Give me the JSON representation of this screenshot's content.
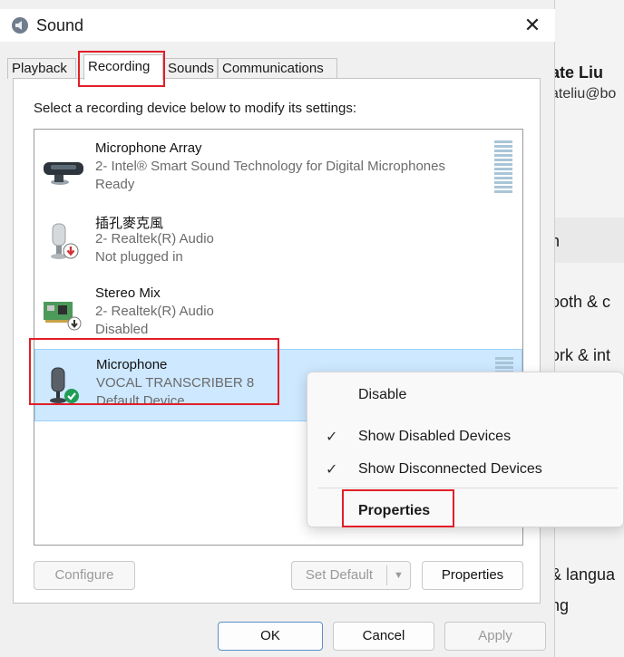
{
  "background_window": {
    "user_name": "ate Liu",
    "user_email": "ateliu@bo",
    "items": [
      "n",
      "ooth & c",
      "ork & int",
      "& langua",
      "ng"
    ],
    "stray_chars": [
      ")"
    ]
  },
  "dialog": {
    "title": "Sound",
    "close_glyph": "✕",
    "tabs": [
      {
        "label": "Playback"
      },
      {
        "label": "Recording"
      },
      {
        "label": "Sounds"
      },
      {
        "label": "Communications"
      }
    ],
    "hint": "Select a recording device below to modify its settings:",
    "devices": [
      {
        "name": "Microphone Array",
        "sub": "2- Intel® Smart Sound Technology for Digital Microphones",
        "status": "Ready",
        "icon": "microphone-array-icon"
      },
      {
        "name": "插孔麥克風",
        "sub": "2- Realtek(R) Audio",
        "status": "Not plugged in",
        "icon": "jack-microphone-icon"
      },
      {
        "name": "Stereo Mix",
        "sub": "2- Realtek(R) Audio",
        "status": "Disabled",
        "icon": "sound-card-icon"
      },
      {
        "name": "Microphone",
        "sub": "VOCAL TRANSCRIBER 8",
        "status": "Default Device",
        "icon": "usb-microphone-icon"
      }
    ],
    "buttons": {
      "configure": "Configure",
      "set_default": "Set Default",
      "properties": "Properties",
      "ok": "OK",
      "cancel": "Cancel",
      "apply": "Apply"
    }
  },
  "context_menu": {
    "items": [
      {
        "label": "Disable",
        "checked": false
      },
      {
        "label": "Show Disabled Devices",
        "checked": true
      },
      {
        "label": "Show Disconnected Devices",
        "checked": true
      },
      {
        "label": "Properties",
        "checked": false
      }
    ],
    "check_glyph": "✓"
  },
  "colors": {
    "highlight": "#e21e28",
    "selection_bg": "#cde8ff",
    "status_ok": "#1f9d55",
    "status_unplugged": "#d13438"
  }
}
